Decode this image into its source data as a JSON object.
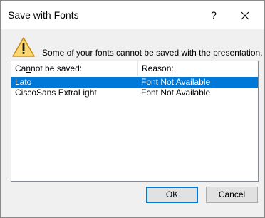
{
  "titlebar": {
    "title": "Save with Fonts",
    "help_label": "?",
    "close_icon": "close-icon"
  },
  "message": {
    "icon": "warning-icon",
    "text": "Some of your fonts cannot be saved with the presentation."
  },
  "list": {
    "headers": {
      "col1_prefix": "Ca",
      "col1_access": "n",
      "col1_suffix": "not be saved:",
      "col2": "Reason:"
    },
    "rows": [
      {
        "font": "Lato",
        "reason": "Font Not Available",
        "selected": true
      },
      {
        "font": "CiscoSans ExtraLight",
        "reason": "Font Not Available",
        "selected": false
      }
    ]
  },
  "buttons": {
    "ok": "OK",
    "cancel": "Cancel"
  },
  "colors": {
    "selection": "#0078d7",
    "warning": "#e8a317"
  }
}
